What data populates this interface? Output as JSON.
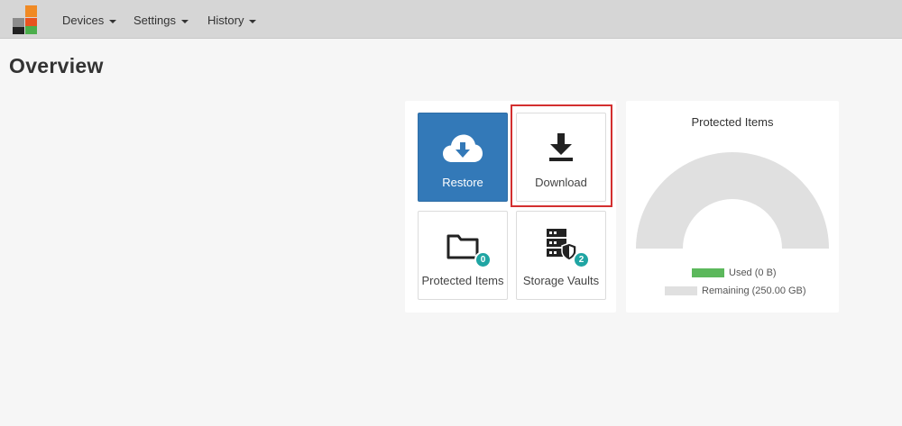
{
  "nav": {
    "items": [
      {
        "label": "Devices"
      },
      {
        "label": "Settings"
      },
      {
        "label": "History"
      }
    ]
  },
  "page": {
    "title": "Overview"
  },
  "tiles": {
    "restore": {
      "label": "Restore",
      "icon": "cloud-download-icon"
    },
    "download": {
      "label": "Download",
      "icon": "download-arrow-icon"
    },
    "protected_items": {
      "label": "Protected Items",
      "icon": "folder-icon",
      "badge": "0"
    },
    "storage_vaults": {
      "label": "Storage Vaults",
      "icon": "server-shield-icon",
      "badge": "2"
    }
  },
  "chart_data": {
    "type": "pie",
    "title": "Protected Items",
    "style": "half-donut gauge",
    "series": [
      {
        "name": "Used (0 B)",
        "value": 0,
        "color": "#5cb85c"
      },
      {
        "name": "Remaining (250.00 GB)",
        "value": 250,
        "color": "#e0e0e0"
      }
    ],
    "legend_placement": "bottom"
  },
  "colors": {
    "accent": "#3379b8",
    "badge": "#1fa5a3",
    "highlight": "#d32f2f",
    "used": "#5cb85c",
    "remaining": "#e0e0e0"
  }
}
